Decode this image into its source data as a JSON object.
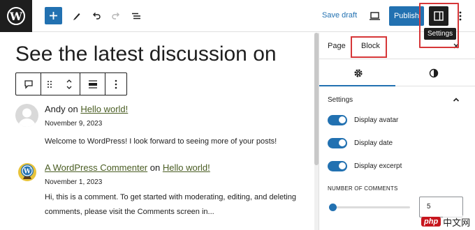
{
  "toolbar": {
    "save_draft_label": "Save draft",
    "publish_label": "Publish",
    "settings_tooltip": "Settings",
    "icons": [
      "wordpress-logo",
      "plus-icon",
      "pencil-icon",
      "undo-icon",
      "redo-icon",
      "list-view-icon",
      "desktop-preview-icon",
      "sidebar-toggle-icon",
      "more-options-icon"
    ]
  },
  "editor": {
    "title": "See the latest discussion on",
    "block_toolbar_icons": [
      "comment-icon",
      "drag-handle-icon",
      "move-up-down-icon",
      "align-icon",
      "more-options-icon"
    ],
    "comments": [
      {
        "author": "Andy",
        "on_text": "on",
        "post": "Hello world!",
        "date": "November 9, 2023",
        "body": "Welcome to WordPress! I look forward to seeing more of your posts!"
      },
      {
        "author": "A WordPress Commenter",
        "on_text": "on",
        "post": "Hello world!",
        "date": "November 1, 2023",
        "body": "Hi, this is a comment. To get started with moderating, editing, and deleting comments, please visit the Comments screen in..."
      }
    ]
  },
  "sidebar": {
    "tabs": [
      "Page",
      "Block"
    ],
    "active_tab": "Block",
    "sub_tab_icons": [
      "gear-icon",
      "styles-icon"
    ],
    "section_title": "Settings",
    "toggles": [
      {
        "label": "Display avatar",
        "on": true
      },
      {
        "label": "Display date",
        "on": true
      },
      {
        "label": "Display excerpt",
        "on": true
      }
    ],
    "number_of_comments_label": "NUMBER OF COMMENTS",
    "number_of_comments_value": "5",
    "range_fraction": 0.04
  },
  "watermark": {
    "logo": "php",
    "text": "中文网"
  },
  "colors": {
    "accent": "#2271b1",
    "highlight": "#d63638",
    "dark": "#1e1e1e"
  }
}
